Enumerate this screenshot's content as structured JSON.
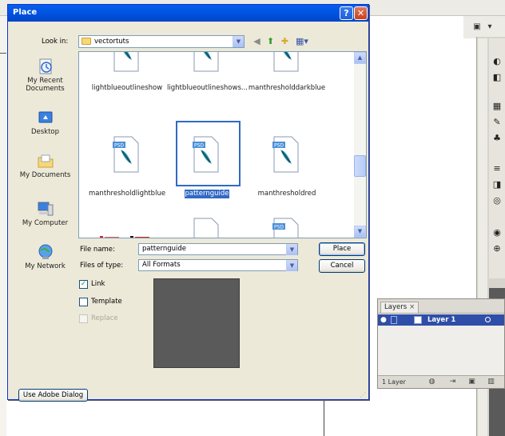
{
  "dialog": {
    "title": "Place",
    "help_glyph": "?",
    "close_glyph": "✕",
    "look_in_label": "Look in:",
    "look_in_value": "vectortuts",
    "file_name_label": "File name:",
    "file_name_value": "patternguide",
    "files_of_type_label": "Files of type:",
    "files_of_type_value": "All Formats",
    "place_button": "Place",
    "cancel_button": "Cancel",
    "use_adobe_dialog_button": "Use Adobe Dialog",
    "options": {
      "link": {
        "label": "Link",
        "checked": true,
        "enabled": true
      },
      "template": {
        "label": "Template",
        "checked": false,
        "enabled": true
      },
      "replace": {
        "label": "Replace",
        "checked": false,
        "enabled": false
      }
    },
    "places": [
      {
        "label": "My Recent Documents",
        "icon": "recent-documents-icon"
      },
      {
        "label": "Desktop",
        "icon": "desktop-icon"
      },
      {
        "label": "My Documents",
        "icon": "my-documents-icon"
      },
      {
        "label": "My Computer",
        "icon": "my-computer-icon"
      },
      {
        "label": "My Network",
        "icon": "my-network-icon"
      }
    ],
    "files": [
      {
        "name": "lightblueoutlineshow"
      },
      {
        "name": "lightblueoutlineshows..."
      },
      {
        "name": "manthresholddarkblue"
      },
      {
        "name": "manthresholdlightblue"
      },
      {
        "name": "patternguide",
        "selected": true
      },
      {
        "name": "manthresholdred"
      }
    ],
    "file_badge": "PSD"
  },
  "layers_panel": {
    "tab_label": "Layers",
    "tab_close": "×",
    "layer_name": "Layer 1",
    "footer_count": "1 Layer"
  },
  "colors": {
    "titlebar": "#0055e5",
    "selection": "#316ac5",
    "dialog_bg": "#ece9d8",
    "preview": "#5a5a5a"
  }
}
